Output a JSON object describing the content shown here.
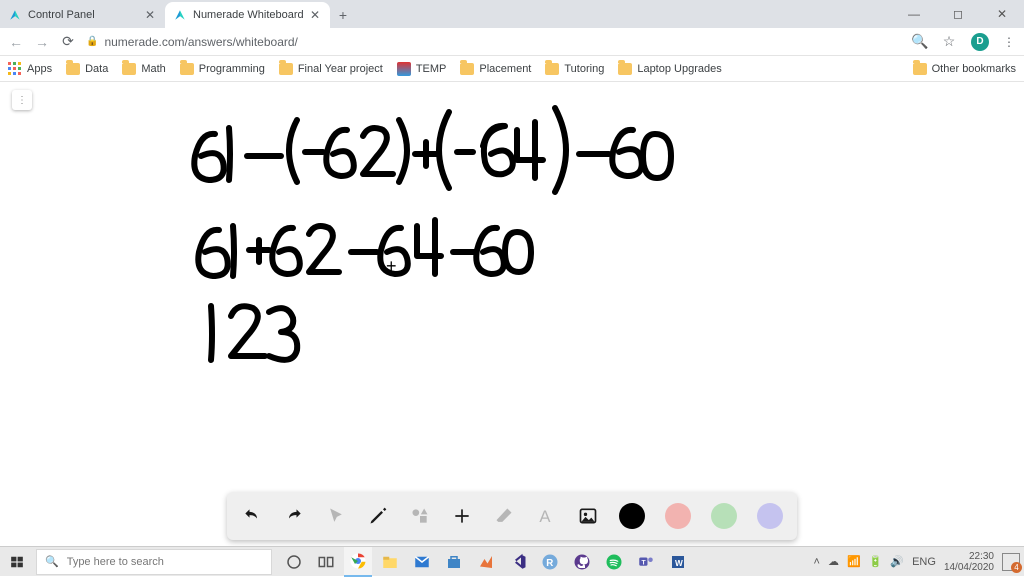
{
  "tabs": [
    {
      "title": "Control Panel",
      "active": false
    },
    {
      "title": "Numerade Whiteboard",
      "active": true
    }
  ],
  "window_controls": {
    "min": "—",
    "max": "◻",
    "close": "✕"
  },
  "address_bar": {
    "url": "numerade.com/answers/whiteboard/",
    "avatar_letter": "D"
  },
  "bookmarks": {
    "apps": "Apps",
    "items": [
      "Data",
      "Math",
      "Programming",
      "Final Year project",
      "TEMP",
      "Placement",
      "Tutoring",
      "Laptop Upgrades"
    ],
    "other": "Other bookmarks"
  },
  "whiteboard": {
    "lines": [
      "61 − (−62) + (−64) − 60",
      "61 + 62 − 64 − 60",
      "123"
    ],
    "cursor_glyph": "+"
  },
  "wb_toolbar": {
    "colors": [
      "#000000",
      "#f2b3b0",
      "#b7e0b8",
      "#c5c3ef"
    ],
    "selected_color": 0
  },
  "taskbar": {
    "search_placeholder": "Type here to search",
    "tray_text": "ENG",
    "time": "22:30",
    "date": "14/04/2020",
    "notif_count": "4"
  }
}
